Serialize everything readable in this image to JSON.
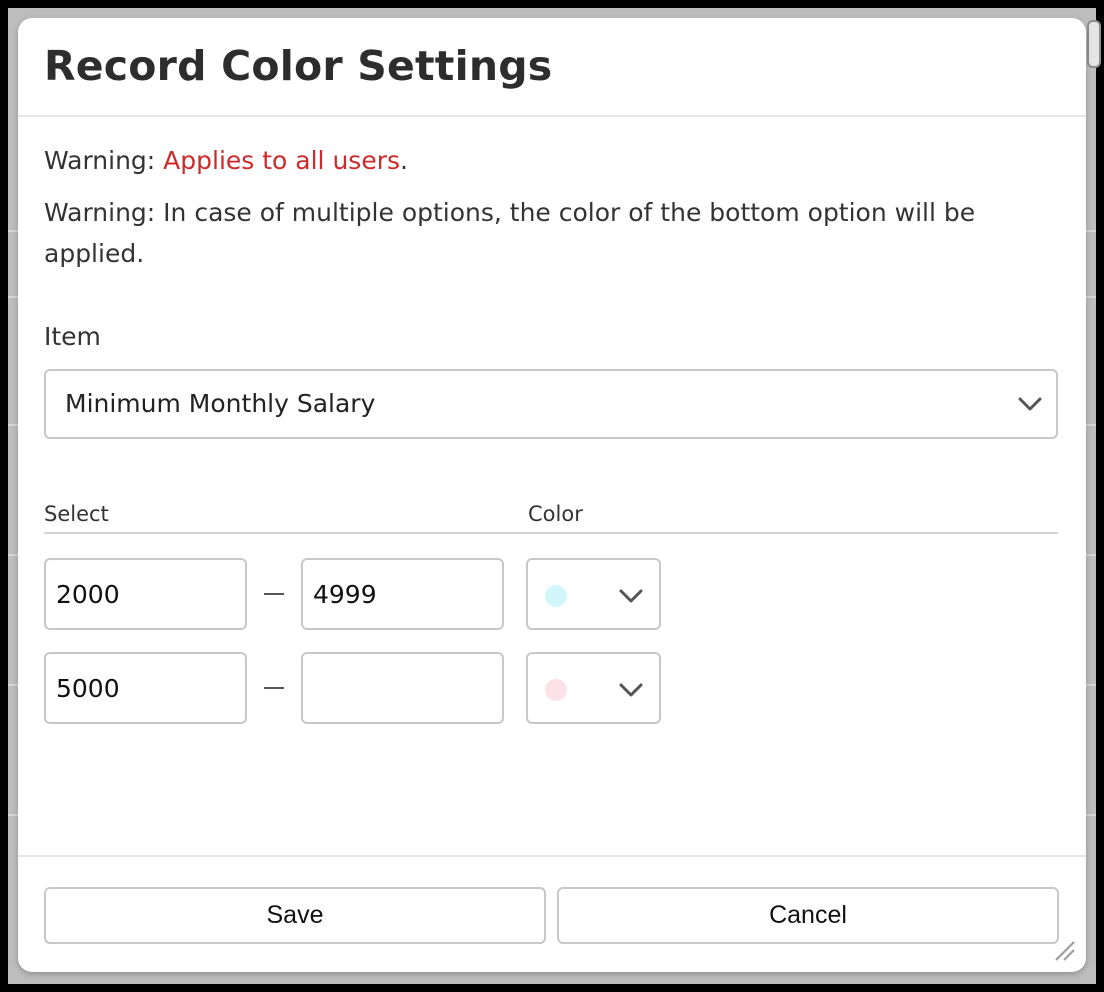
{
  "dialog": {
    "title": "Record Color Settings",
    "warning_prefix": "Warning: ",
    "warning_highlight": "Applies to all users",
    "warning_suffix": ".",
    "warning_multiple": "Warning: In case of multiple options, the color of the bottom option will be applied."
  },
  "item": {
    "label": "Item",
    "selected": "Minimum Monthly Salary"
  },
  "columns": {
    "select": "Select",
    "color": "Color"
  },
  "ranges": [
    {
      "from": "2000",
      "to": "4999",
      "color": "#d3f6fb"
    },
    {
      "from": "5000",
      "to": "",
      "color": "#fde1e9"
    }
  ],
  "icons": {
    "item_dropdown": "chevron-down-icon",
    "color_dropdown": "chevron-down-icon",
    "resize": "resize-handle-icon"
  },
  "buttons": {
    "save": "Save",
    "cancel": "Cancel"
  },
  "colors": {
    "warning_text": "#cc2b2b"
  }
}
